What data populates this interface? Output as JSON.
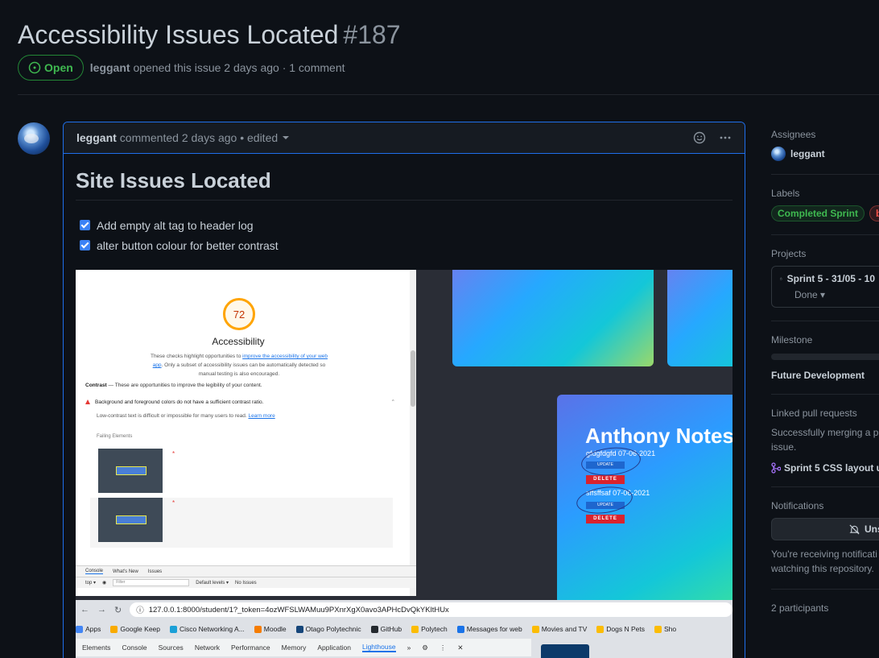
{
  "issue": {
    "title": "Accessibility Issues Located",
    "number": "#187",
    "state": "Open",
    "author": "leggant",
    "meta": "opened this issue 2 days ago · 1 comment"
  },
  "comment": {
    "author": "leggant",
    "meta": "commented 2 days ago • edited",
    "heading": "Site Issues Located",
    "tasks": [
      {
        "label": "Add empty alt tag to header log",
        "checked": true
      },
      {
        "label": "alter button colour for better contrast",
        "checked": true
      }
    ]
  },
  "screenshot": {
    "lighthouse": {
      "score": "72",
      "category": "Accessibility",
      "desc_pre": "These checks highlight opportunities to ",
      "desc_link": "improve the accessibility of your web app",
      "desc_post": ". Only a subset of accessibility issues can be automatically detected so manual testing is also encouraged.",
      "contrast_label": "Contrast",
      "contrast_text": " — These are opportunities to improve the legibility of your content.",
      "audit": "Background and foreground colors do not have a sufficient contrast ratio.",
      "low_contrast": "Low-contrast text is difficult or impossible for many users to read.",
      "learn_more": "Learn more",
      "failing": "Failing Elements",
      "star": "*"
    },
    "console_tabs": [
      "Console",
      "What's New",
      "Issues"
    ],
    "console_row": {
      "top": "top ▾",
      "filter": "Filter",
      "levels": "Default levels ▾",
      "issues": "No Issues"
    },
    "app": {
      "title": "Anthony Notes",
      "note1": "gfdgfdgfd 07-06-2021",
      "note2": "sffsffsaf 07-06-2021",
      "update": "UPDATE",
      "delete": "DELETE"
    },
    "browser": {
      "url": "127.0.0.1:8000/student/1?_token=4ozWFSLWAMuu9PXnrXgX0avo3APHcDvQkYKltHUx",
      "bookmarks": [
        "Apps",
        "Google Keep",
        "Cisco Networking A...",
        "Moodle",
        "Otago Polytechnic",
        "GitHub",
        "Polytech",
        "Messages for web",
        "Movies and TV",
        "Dogs N Pets",
        "Sho"
      ],
      "bookmark_colors": [
        "#4285f4",
        "#f9ab00",
        "#1ba0d7",
        "#f57c00",
        "#16467a",
        "#24292e",
        "#fbbc04",
        "#1a73e8",
        "#fbbc04",
        "#fbbc04",
        "#fbbc04"
      ],
      "devtools_tabs": [
        "Elements",
        "Console",
        "Sources",
        "Network",
        "Performance",
        "Memory",
        "Application",
        "Lighthouse",
        "»"
      ]
    }
  },
  "sidebar": {
    "assignees_h": "Assignees",
    "assignee": "leggant",
    "labels_h": "Labels",
    "labels": [
      "Completed Sprint",
      "bug"
    ],
    "projects_h": "Projects",
    "project_name": "Sprint 5 - 31/05 - 10",
    "project_status": "Done ▾",
    "milestone_h": "Milestone",
    "milestone": "Future Development",
    "linked_h": "Linked pull requests",
    "linked_text1": "Successfully merging a pu",
    "linked_text2": "issue.",
    "linked_pr": "Sprint 5 CSS layout u",
    "notif_h": "Notifications",
    "unsub": "Uns",
    "notif_text1": "You're receiving notificati",
    "notif_text2": "watching this repository.",
    "participants": "2 participants"
  },
  "colors": {
    "accent": "#1f6feb",
    "open": "#3fb950",
    "bg": "#0d1117"
  }
}
